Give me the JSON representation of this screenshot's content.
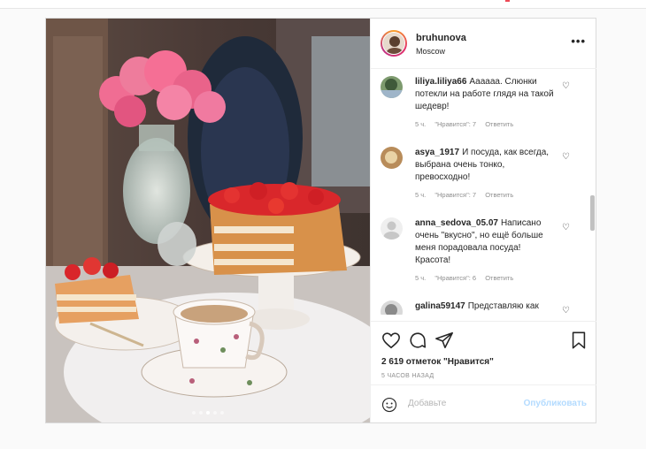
{
  "post": {
    "username": "bruhunova",
    "location": "Moscow",
    "more_label": "•••",
    "likes": "2 619 отметок \"Нравится\"",
    "time": "5 ЧАСОВ НАЗАД",
    "comment_placeholder": "Добавьте",
    "publish_label": "Опубликовать",
    "carousel_count": 5,
    "carousel_active": 2
  },
  "comments": [
    {
      "user": "liliya.liliya66",
      "text": "Аааааа. Слюнки потекли на работе глядя на такой шедевр!",
      "time": "5 ч.",
      "likes": "\"Нравится\": 7",
      "reply": "Ответить"
    },
    {
      "user": "asya_1917",
      "text": "И посуда, как всегда, выбрана очень тонко, превосходно!",
      "time": "5 ч.",
      "likes": "\"Нравится\": 7",
      "reply": "Ответить"
    },
    {
      "user": "anna_sedova_05.07",
      "text": "Написано очень \"вкусно\", но ещё больше меня порадовала посуда! Красота!",
      "time": "5 ч.",
      "likes": "\"Нравится\": 6",
      "reply": "Ответить"
    },
    {
      "user": "galina59147",
      "text": "Представляю как",
      "time": "",
      "likes": "",
      "reply": ""
    }
  ]
}
